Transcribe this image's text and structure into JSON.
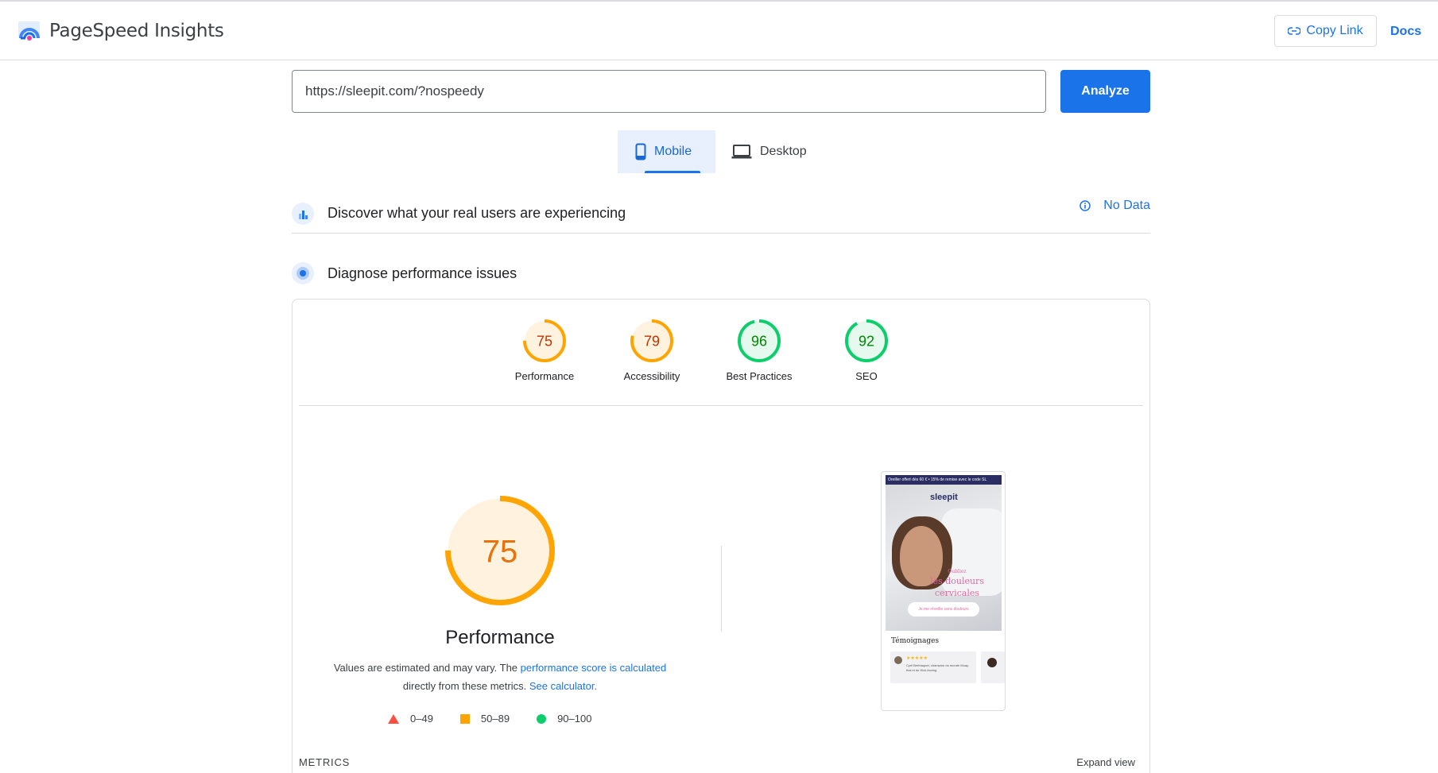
{
  "header": {
    "title": "PageSpeed Insights",
    "copy_link": "Copy Link",
    "docs": "Docs"
  },
  "search": {
    "url": "https://sleepit.com/?nospeedy",
    "analyze": "Analyze"
  },
  "tabs": [
    {
      "label": "Mobile",
      "selected": true
    },
    {
      "label": "Desktop",
      "selected": false
    }
  ],
  "discover": {
    "title": "Discover what your real users are experiencing",
    "status": "No Data"
  },
  "diagnose": {
    "title": "Diagnose performance issues"
  },
  "scores": [
    {
      "label": "Performance",
      "score": "75",
      "value": 75,
      "color": "#ffa400",
      "text_color": "#c33300",
      "fill": "#fff3e0"
    },
    {
      "label": "Accessibility",
      "score": "79",
      "value": 79,
      "color": "#ffa400",
      "text_color": "#c33300",
      "fill": "#fff3e0"
    },
    {
      "label": "Best Practices",
      "score": "96",
      "value": 96,
      "color": "#0cce6b",
      "text_color": "#008800",
      "fill": "#e6f9ee"
    },
    {
      "label": "SEO",
      "score": "92",
      "value": 92,
      "color": "#0cce6b",
      "text_color": "#008800",
      "fill": "#e6f9ee"
    }
  ],
  "performance": {
    "score": "75",
    "value": 75,
    "title": "Performance",
    "desc_prefix": "Values are estimated and may vary. The ",
    "desc_link1": "performance score is calculated",
    "desc_middle": "directly from these metrics. ",
    "desc_link2": "See calculator."
  },
  "legend": [
    {
      "range": "0–49",
      "shape": "triangle",
      "color": "#ff4e42"
    },
    {
      "range": "50–89",
      "shape": "square",
      "color": "#ffa400"
    },
    {
      "range": "90–100",
      "shape": "circle",
      "color": "#0cce6b"
    }
  ],
  "screenshot": {
    "topbar": "Oreiller offert dès 60 € • 15% de remise avec le code SL",
    "logo": "sleepit",
    "hero_small": "Oubliez",
    "hero_text": "les douleurs cervicales",
    "cta": "Je me réveille sans douleurs",
    "testimonials": "Témoignages",
    "review": "Cyril Berthaquet, champion du monde Muay-thai et de Kick-boxing"
  },
  "metrics": {
    "label": "METRICS",
    "expand": "Expand view"
  },
  "colors": {
    "accent": "#1a73e8",
    "tab_bg": "#e8f0fe",
    "border": "#dadce0"
  }
}
